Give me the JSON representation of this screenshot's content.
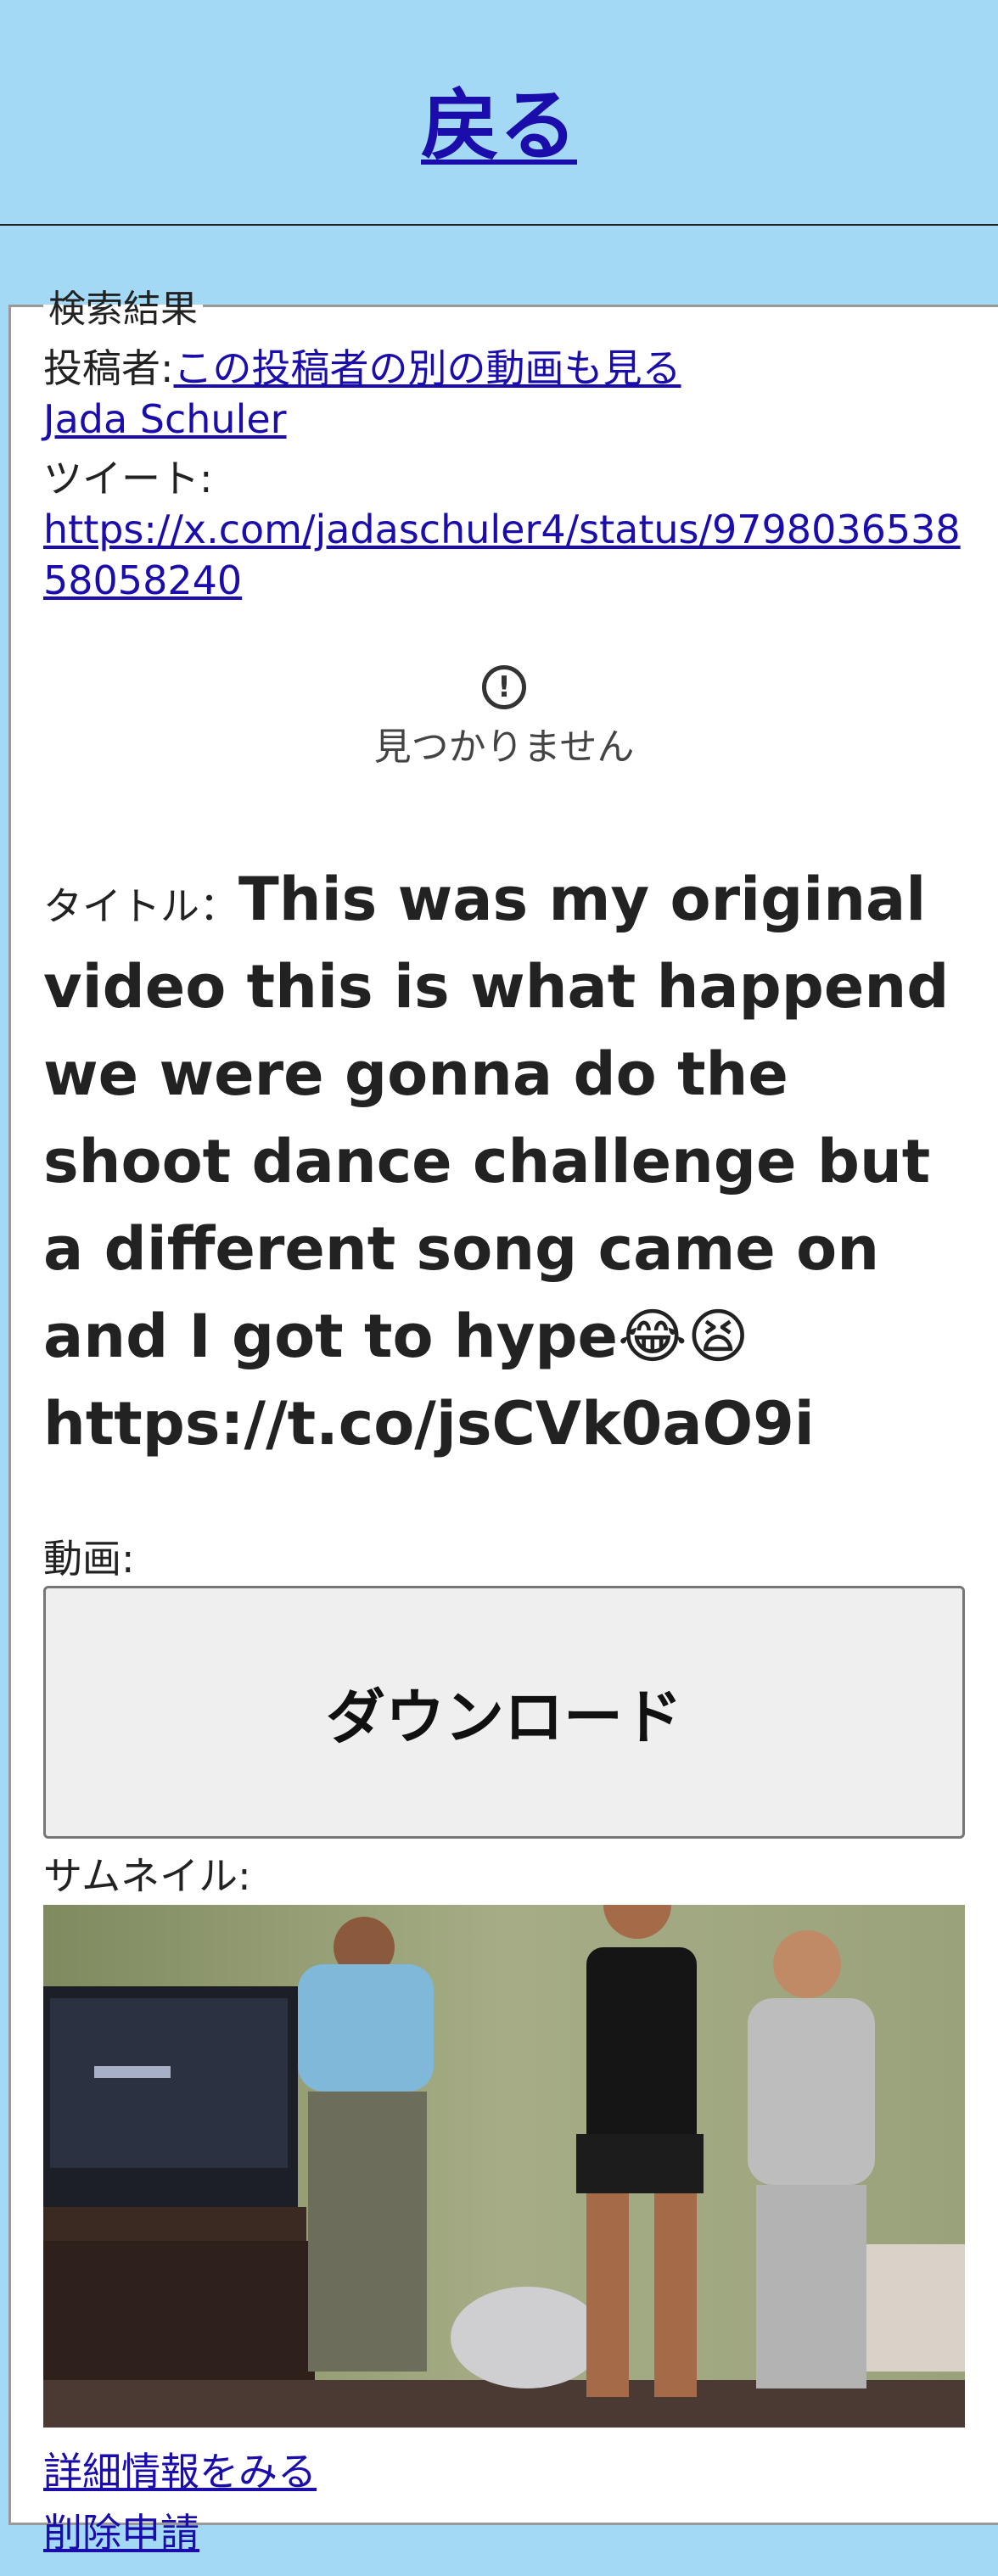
{
  "header": {
    "back_label": "戻る"
  },
  "results": {
    "legend": "検索結果",
    "poster_label": "投稿者:",
    "other_videos_link": "この投稿者の別の動画も見る",
    "poster_name": "Jada Schuler",
    "tweet_label": "ツイート:",
    "tweet_url": "https://x.com/jadaschuler4/status/979803653858058240",
    "embed_status": "見つかりません",
    "title_label": "タイトル：",
    "title_text": "This was my original video this is what happend we were gonna do the shoot dance challenge but a different song came on and I got to hype😂😫 https://t.co/jsCVk0aO9i",
    "video_label": "動画:",
    "download_label": "ダウンロード",
    "thumbnail_label": "サムネイル:",
    "details_link": "詳細情報をみる",
    "delete_request_link": "削除申請"
  },
  "colors": {
    "page_background": "#a3d9f5",
    "link": "#1a0dab",
    "panel_background": "#ffffff"
  }
}
